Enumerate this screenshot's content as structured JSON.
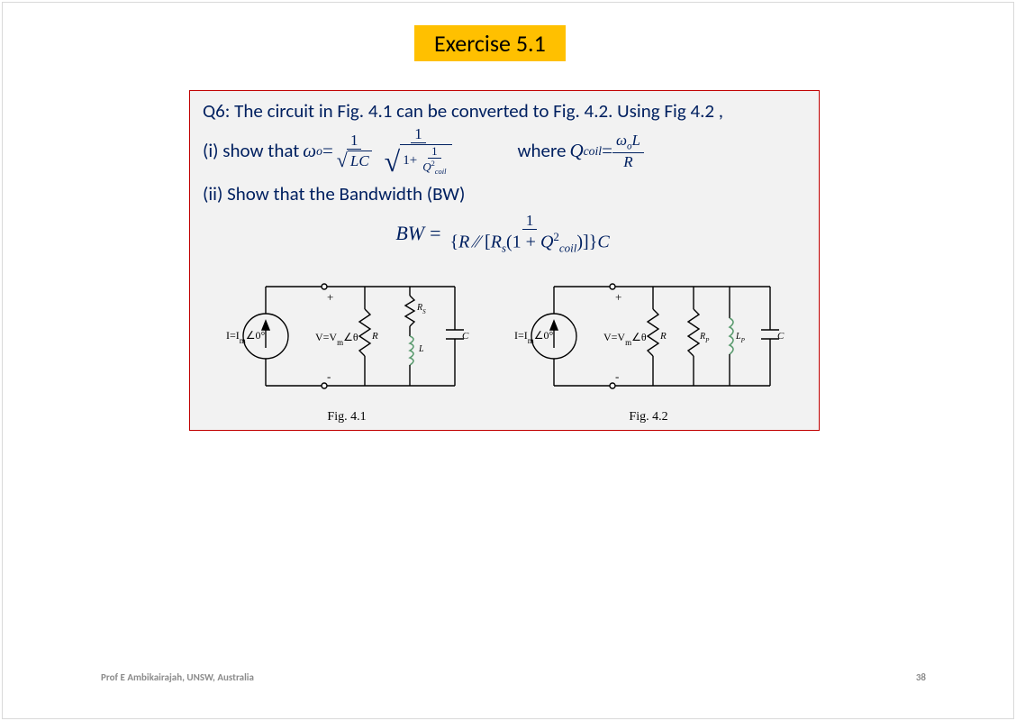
{
  "title": "Exercise 5.1",
  "q_line1": "Q6: The circuit in Fig. 4.1  can be converted to Fig. 4.2.  Using Fig 4.2 ,",
  "part_i_label": "(i) show that ",
  "omega_o": "ω",
  "omega_sub": "o",
  "equals": " = ",
  "one": "1",
  "LC": "LC",
  "where_label": "where ",
  "Q_label": "Q",
  "coil_sub": "coil",
  "R_label": "R",
  "L_label": "L",
  "part_ii": "(ii) Show that the Bandwidth (BW)",
  "BW": "BW",
  "one2": "1",
  "Rs_label": "R",
  "s_sub": "s",
  "C_label": "C",
  "parallel": "∕∕",
  "fig41_caption": "Fig. 4.1",
  "fig42_caption": "Fig. 4.2",
  "isrc": "I=I",
  "isrc_m": "m",
  "isrc_ang": "∠0°",
  "vlabel": "V=V",
  "v_m": "m",
  "v_ang": "∠θ",
  "plus": "+",
  "minus": "-",
  "Rp_label": "R",
  "p_sub": "P",
  "Lp_label": "L",
  "footer_left": "Prof  E  Ambikairajah, UNSW, Australia",
  "footer_right": "38"
}
